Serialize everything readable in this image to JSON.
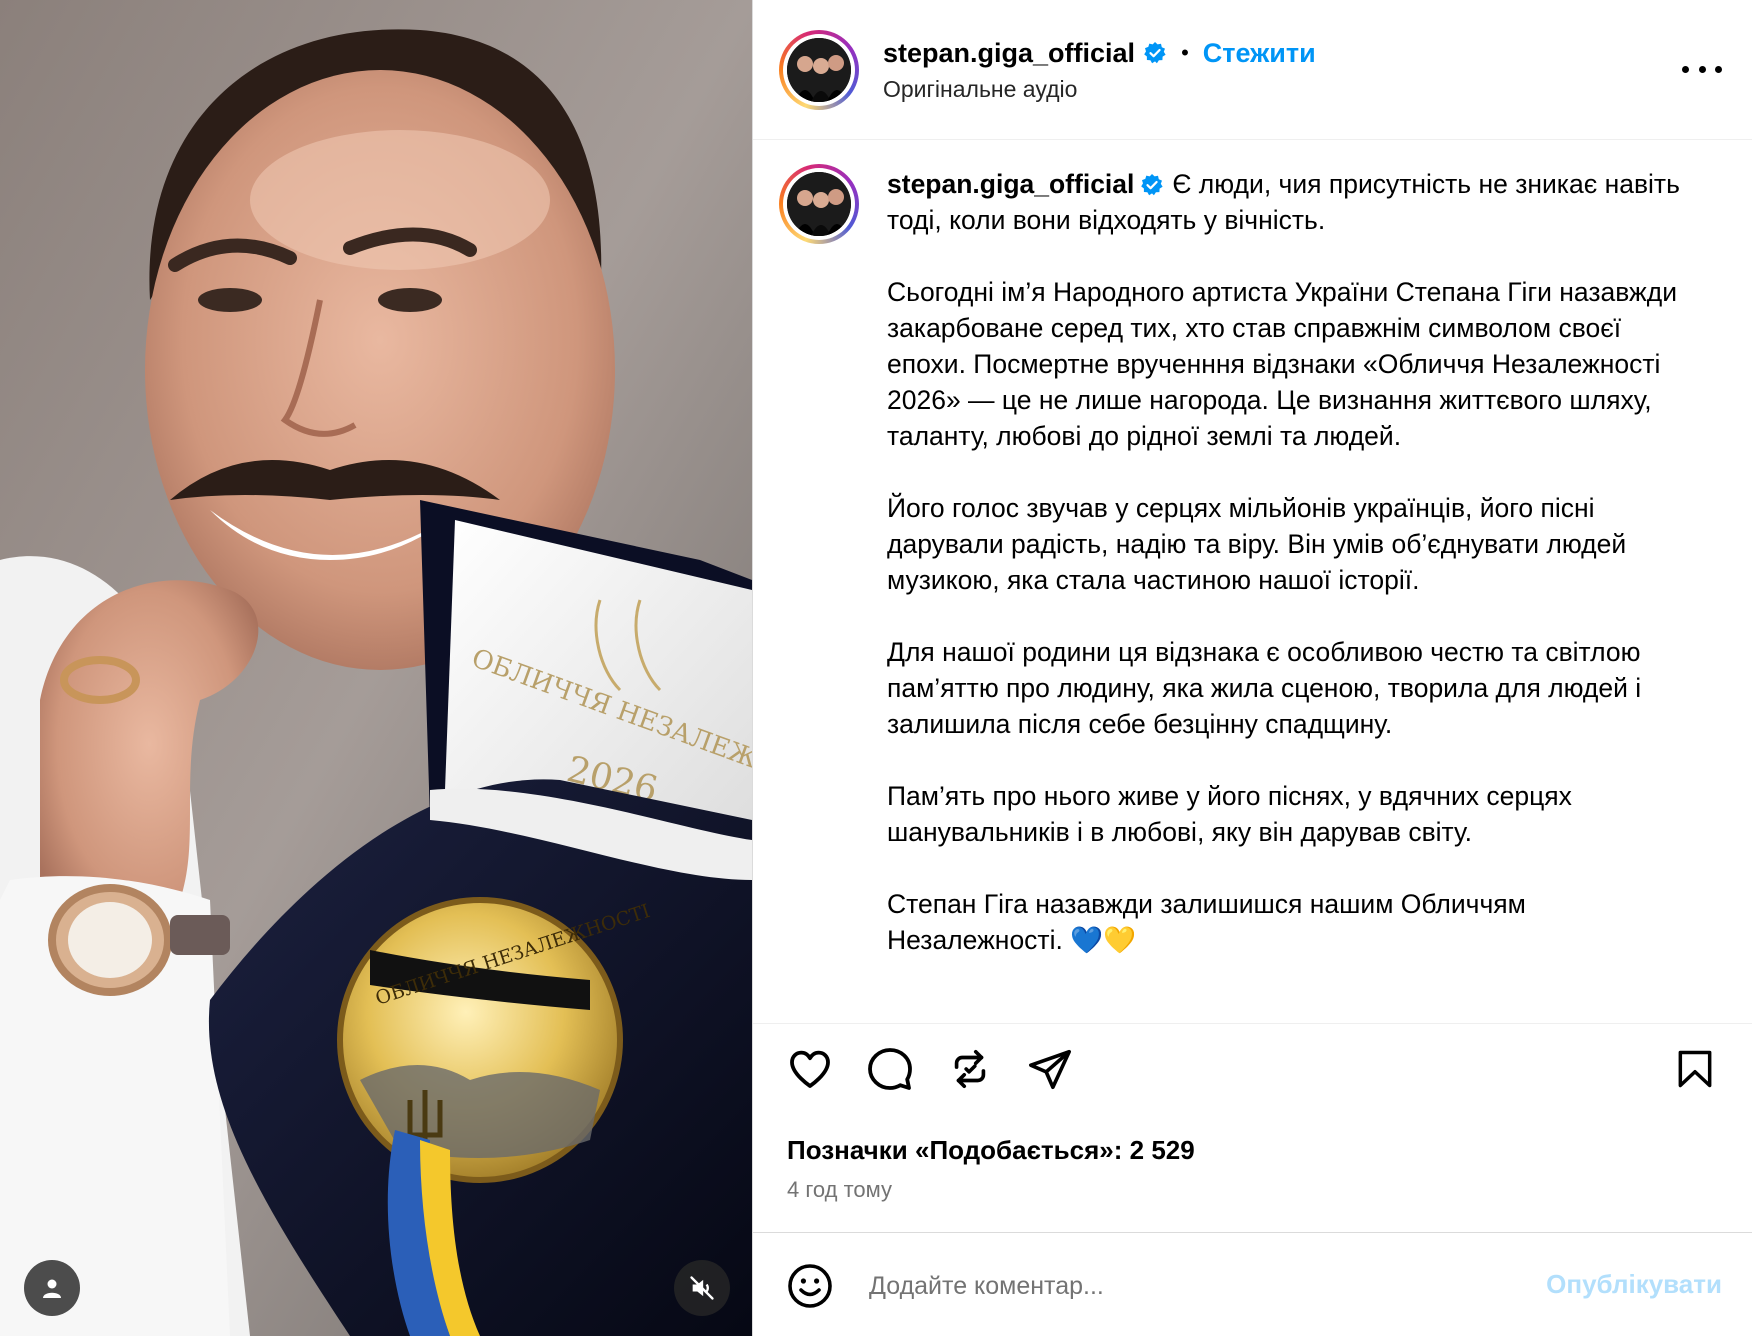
{
  "post": {
    "username": "stepan.giga_official",
    "follow_label": "Стежити",
    "separator": "•",
    "audio_label": "Оригінальне аудіо",
    "more_icon": "more-horizontal-icon"
  },
  "caption": {
    "username": "stepan.giga_official",
    "first_paragraph": "Є люди, чия присутність не зникає навіть тоді, коли вони відходять у вічність.",
    "paragraphs": [
      "Сьогодні ім’я Народного артиста України Степана Гіги назавжди закарбоване серед тих, хто став справжнім символом своєї епохи. Посмертне врученння відзнаки «Обличчя Незалежності 2026» — це не лише нагорода. Це визнання життєвого шляху, таланту, любові до рідної землі та людей.",
      "Його голос звучав у серцях мільйонів українців, його пісні дарували радість, надію та віру. Він умів об’єднувати людей музикою, яка стала частиною нашої історії.",
      "Для нашої родини ця відзнака є особливою честю та світлою пам’яттю про людину, яка жила сценою, творила для людей і залишила після себе безцінну спадщину.",
      "Пам’ять про нього живе у його піснях, у вдячних серцях шанувальників і в любові, яку він дарував світу.",
      "Степан Гіга назавжди залишишся нашим Обличчям Незалежності. 💙💛"
    ]
  },
  "photo": {
    "box_text": "ОБЛИЧЧЯ НЕЗАЛЕЖНО",
    "box_year": "2026",
    "medal_text": "ОБЛИЧЧЯ НЕЗАЛЕЖНОСТІ"
  },
  "actions": {
    "icons": [
      "heart-icon",
      "comment-icon",
      "repost-icon",
      "share-icon",
      "bookmark-icon"
    ]
  },
  "likes": {
    "label": "Позначки «Подобається»:",
    "count": "2 529"
  },
  "time_ago": "4 год тому",
  "comment": {
    "placeholder": "Додайте коментар...",
    "publish_label": "Опублікувати"
  },
  "colors": {
    "link_blue": "#0095f6",
    "publish_disabled": "#b2dffc",
    "verified_blue": "#0095f6",
    "secondary_text": "#737373"
  }
}
